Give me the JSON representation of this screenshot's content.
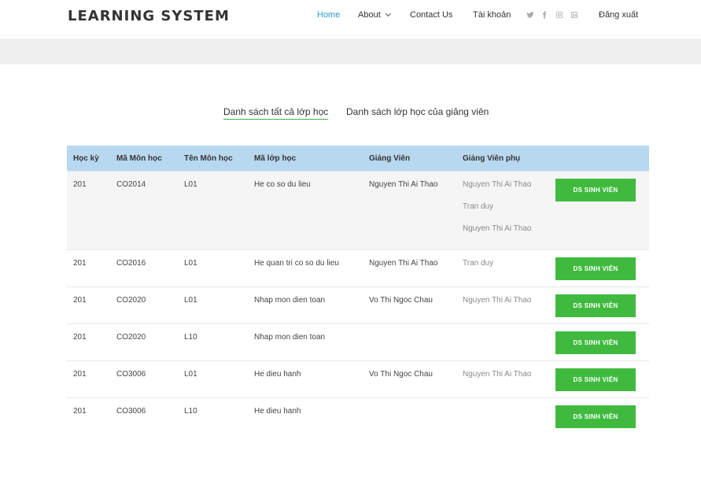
{
  "header": {
    "brand": "LEARNING SYSTEM",
    "nav": {
      "home": "Home",
      "about": "About",
      "contact": "Contact Us",
      "account": "Tài khoản",
      "logout": "Đăng xuất"
    },
    "social_icons": [
      "twitter-icon",
      "facebook-icon",
      "instagram-icon",
      "linkedin-icon"
    ],
    "active_color": "#2b9bd6"
  },
  "tabs": [
    {
      "label": "Danh sách tất cả lớp học",
      "selected": true
    },
    {
      "label": "Danh sách lớp học của giảng viên",
      "selected": false
    }
  ],
  "table": {
    "headers": [
      "Học kỳ",
      "Mã Môn học",
      "Tên Môn học",
      "Mã lớp học",
      "Giảng Viên",
      "Giảng Viên phụ",
      ""
    ],
    "header_color": "#b8d8f0",
    "button_color": "#3fba3f",
    "rows": [
      {
        "hoc_ky": "201",
        "ma_mon": "CO2014",
        "ten_mon": "L01",
        "ma_lop": "He co so du lieu",
        "giang_vien": "Nguyen Thi Ai Thao",
        "gv_phu": [
          "Nguyen Thi Ai Thao",
          "Tran duy",
          "Nguyen Thi Ai Thao"
        ],
        "button": "DS SINH VIÊN"
      },
      {
        "hoc_ky": "201",
        "ma_mon": "CO2016",
        "ten_mon": "L01",
        "ma_lop": "He quan tri co so du lieu",
        "giang_vien": "Nguyen Thi Ai Thao",
        "gv_phu": [
          "Tran duy"
        ],
        "button": "DS SINH VIÊN"
      },
      {
        "hoc_ky": "201",
        "ma_mon": "CO2020",
        "ten_mon": "L01",
        "ma_lop": "Nhap mon dien toan",
        "giang_vien": "Vo Thi Ngoc Chau",
        "gv_phu": [
          "Nguyen Thi Ai Thao"
        ],
        "button": "DS SINH VIÊN"
      },
      {
        "hoc_ky": "201",
        "ma_mon": "CO2020",
        "ten_mon": "L10",
        "ma_lop": "Nhap mon dien toan",
        "giang_vien": "",
        "gv_phu": [],
        "button": "DS SINH VIÊN"
      },
      {
        "hoc_ky": "201",
        "ma_mon": "CO3006",
        "ten_mon": "L01",
        "ma_lop": "He dieu hanh",
        "giang_vien": "Vo Thi Ngoc Chau",
        "gv_phu": [
          "Nguyen Thi Ai Thao"
        ],
        "button": "DS SINH VIÊN"
      },
      {
        "hoc_ky": "201",
        "ma_mon": "CO3006",
        "ten_mon": "L10",
        "ma_lop": "He dieu hanh",
        "giang_vien": "",
        "gv_phu": [],
        "button": "DS SINH VIÊN"
      }
    ]
  }
}
